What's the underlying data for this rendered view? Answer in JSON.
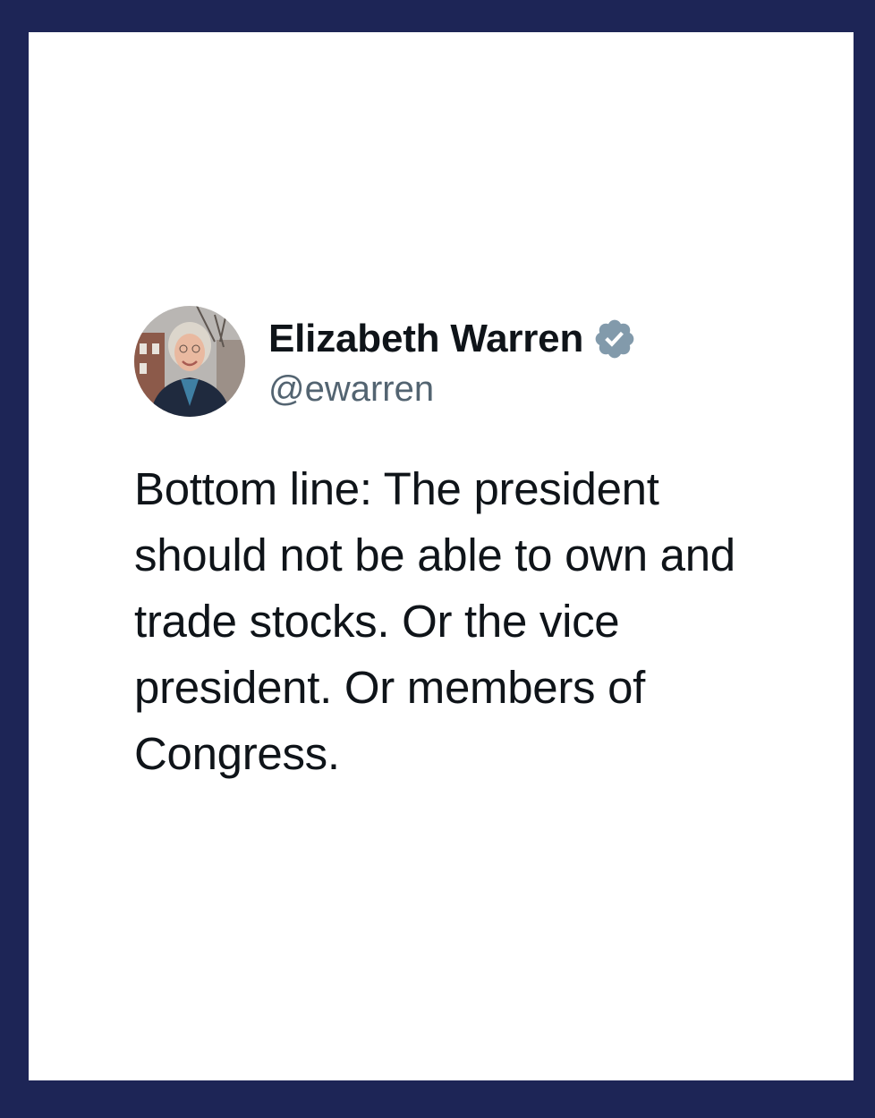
{
  "colors": {
    "frame_background": "#1d2556",
    "card_background": "#ffffff",
    "text_primary": "#0f1419",
    "text_secondary": "#536471",
    "verified_badge": "#829aab"
  },
  "tweet": {
    "author": {
      "display_name": "Elizabeth Warren",
      "handle": "@ewarren",
      "avatar_icon": "profile-photo",
      "verified_icon": "verified-badge-icon"
    },
    "text": "Bottom line: The president should not be able to own and trade stocks. Or the vice president. Or members of Congress."
  }
}
